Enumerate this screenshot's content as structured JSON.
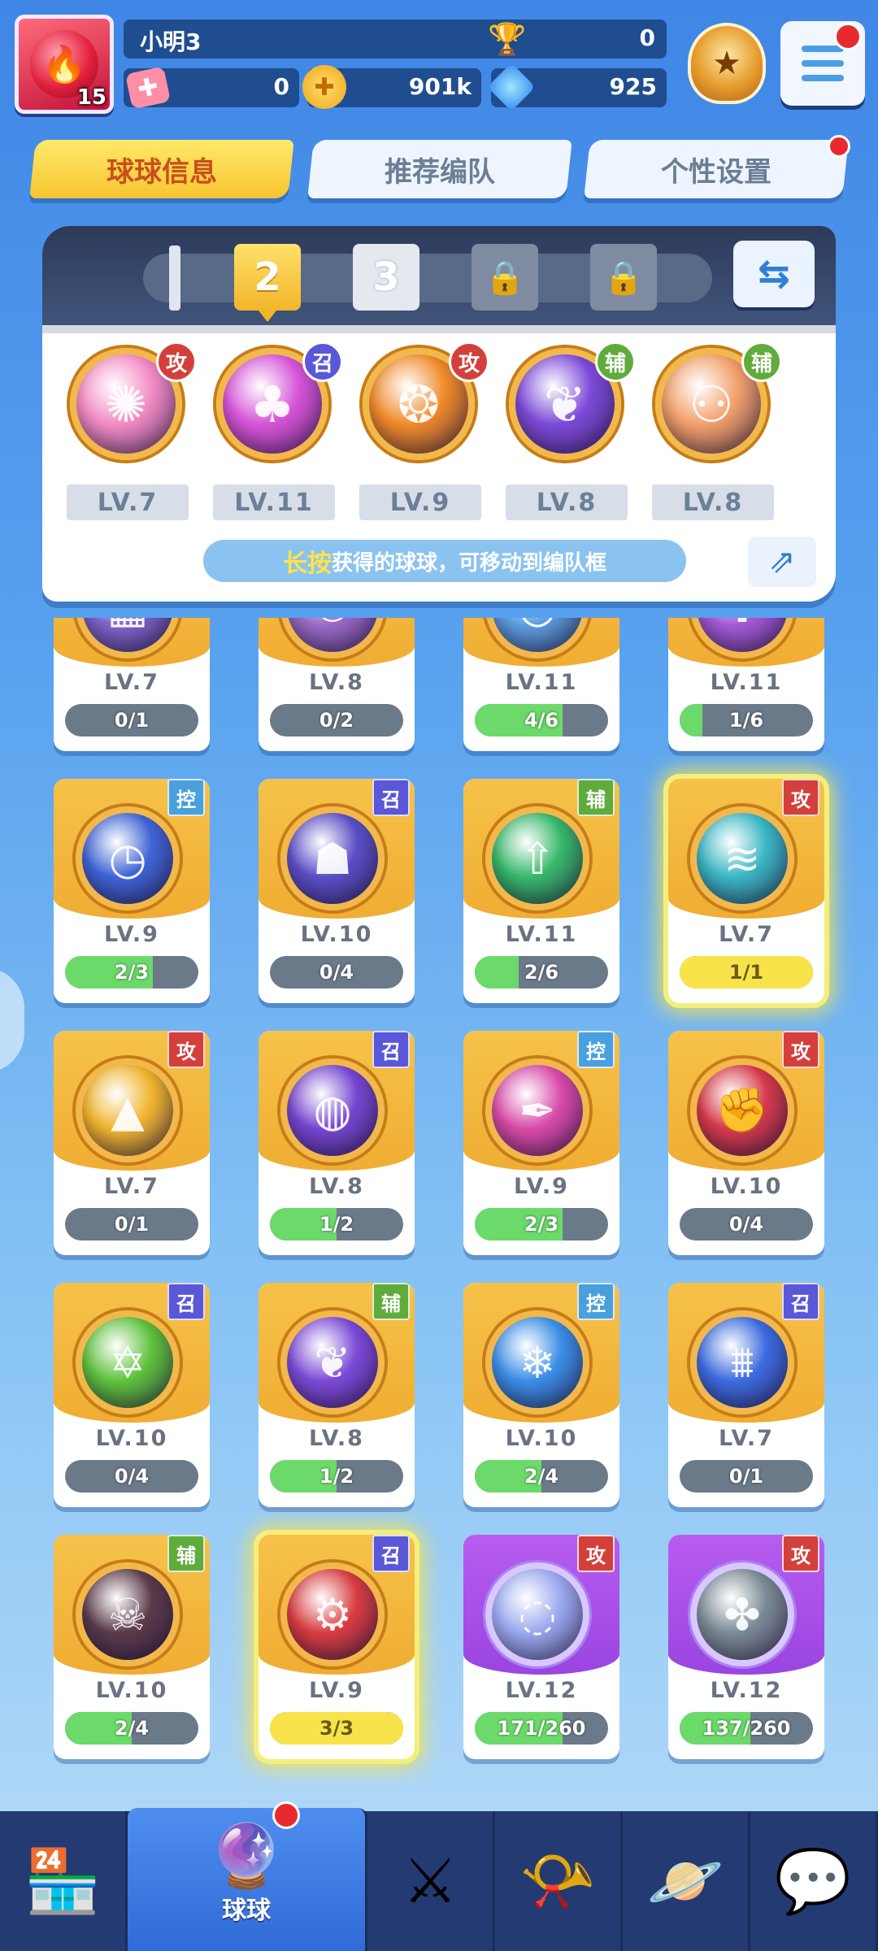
{
  "player": {
    "name": "小明3",
    "level": "15",
    "trophies": "0",
    "tickets": "0",
    "gold": "901k",
    "diamonds": "925"
  },
  "tabs": [
    {
      "label": "球球信息",
      "active": true
    },
    {
      "label": "推荐编队",
      "active": false
    },
    {
      "label": "个性设置",
      "active": false
    }
  ],
  "deck": {
    "slots": [
      {
        "label": "2",
        "state": "active"
      },
      {
        "label": "3",
        "state": "normal"
      },
      {
        "label": "🔒",
        "state": "locked"
      },
      {
        "label": "🔒",
        "state": "locked"
      }
    ],
    "balls": [
      {
        "type": "攻",
        "level": "LV.7",
        "icon": "crystal-burst",
        "color": "#f28bc4"
      },
      {
        "type": "召",
        "level": "LV.11",
        "icon": "mushroom",
        "color": "#d654d8"
      },
      {
        "type": "攻",
        "level": "LV.9",
        "icon": "fire-phoenix",
        "color": "#f08a2a"
      },
      {
        "type": "辅",
        "level": "LV.8",
        "icon": "leaf",
        "color": "#7c4ad8"
      },
      {
        "type": "辅",
        "level": "LV.8",
        "icon": "crowd",
        "color": "#f2a06a"
      }
    ],
    "hint_highlight": "长按",
    "hint_text": "获得的球球，可移动到编队框"
  },
  "cards": [
    {
      "type": "",
      "level": "LV.7",
      "progress": "0/1",
      "ratio": 0,
      "icon": "brick",
      "color": "#7f65c9",
      "variant": "gold"
    },
    {
      "type": "",
      "level": "LV.8",
      "progress": "0/2",
      "ratio": 0,
      "icon": "crowd",
      "color": "#9a6ac8",
      "variant": "gold"
    },
    {
      "type": "",
      "level": "LV.11",
      "progress": "4/6",
      "ratio": 0.66,
      "icon": "swirl",
      "color": "#5c9ee0",
      "variant": "gold"
    },
    {
      "type": "",
      "level": "LV.11",
      "progress": "1/6",
      "ratio": 0.17,
      "icon": "cross",
      "color": "#a35ad6",
      "variant": "gold"
    },
    {
      "type": "控",
      "level": "LV.9",
      "progress": "2/3",
      "ratio": 0.66,
      "icon": "clock",
      "color": "#3f64d6",
      "variant": "gold"
    },
    {
      "type": "召",
      "level": "LV.10",
      "progress": "0/4",
      "ratio": 0,
      "icon": "ghost",
      "color": "#5a4fc6",
      "variant": "gold"
    },
    {
      "type": "辅",
      "level": "LV.11",
      "progress": "2/6",
      "ratio": 0.33,
      "icon": "arrow-up",
      "color": "#36b86a",
      "variant": "gold"
    },
    {
      "type": "攻",
      "level": "LV.7",
      "progress": "1/1",
      "ratio": 1,
      "icon": "tornado",
      "color": "#3ab6c4",
      "variant": "gold",
      "glow": true
    },
    {
      "type": "攻",
      "level": "LV.7",
      "progress": "0/1",
      "ratio": 0,
      "icon": "triangle",
      "color": "#f0b42e",
      "variant": "gold"
    },
    {
      "type": "召",
      "level": "LV.8",
      "progress": "1/2",
      "ratio": 0.5,
      "icon": "orbit",
      "color": "#7646d0",
      "variant": "gold"
    },
    {
      "type": "控",
      "level": "LV.9",
      "progress": "2/3",
      "ratio": 0.66,
      "icon": "dagger",
      "color": "#d84aa8",
      "variant": "gold"
    },
    {
      "type": "攻",
      "level": "LV.10",
      "progress": "0/4",
      "ratio": 0,
      "icon": "fist",
      "color": "#d63a4a",
      "variant": "gold"
    },
    {
      "type": "召",
      "level": "LV.10",
      "progress": "0/4",
      "ratio": 0,
      "icon": "hexagram",
      "color": "#5fc23c",
      "variant": "gold"
    },
    {
      "type": "辅",
      "level": "LV.8",
      "progress": "1/2",
      "ratio": 0.5,
      "icon": "leaf",
      "color": "#7c4ad8",
      "variant": "gold"
    },
    {
      "type": "控",
      "level": "LV.10",
      "progress": "2/4",
      "ratio": 0.5,
      "icon": "snowflake",
      "color": "#3a8ee6",
      "variant": "gold"
    },
    {
      "type": "召",
      "level": "LV.7",
      "progress": "0/1",
      "ratio": 0,
      "icon": "icicles",
      "color": "#3c6be0",
      "variant": "gold"
    },
    {
      "type": "辅",
      "level": "LV.10",
      "progress": "2/4",
      "ratio": 0.5,
      "icon": "skull",
      "color": "#5a3a4a",
      "variant": "gold"
    },
    {
      "type": "召",
      "level": "LV.9",
      "progress": "3/3",
      "ratio": 1,
      "icon": "cannon",
      "color": "#d83c40",
      "variant": "gold",
      "glow": true
    },
    {
      "type": "攻",
      "level": "LV.12",
      "progress": "171/260",
      "ratio": 0.66,
      "icon": "bubble",
      "color": "#9aa8ee",
      "variant": "purple"
    },
    {
      "type": "攻",
      "level": "LV.12",
      "progress": "137/260",
      "ratio": 0.53,
      "icon": "vortex",
      "color": "#7a8a94",
      "variant": "purple"
    }
  ],
  "nav": [
    {
      "label": "",
      "icon": "shop-icon",
      "active": false
    },
    {
      "label": "球球",
      "icon": "ball-icon",
      "active": true
    },
    {
      "label": "",
      "icon": "battle-swords-icon",
      "active": false
    },
    {
      "label": "",
      "icon": "whistle-icon",
      "active": false
    },
    {
      "label": "",
      "icon": "planet-icon",
      "active": false
    },
    {
      "label": "",
      "icon": "chat-heart-icon",
      "active": false
    }
  ]
}
